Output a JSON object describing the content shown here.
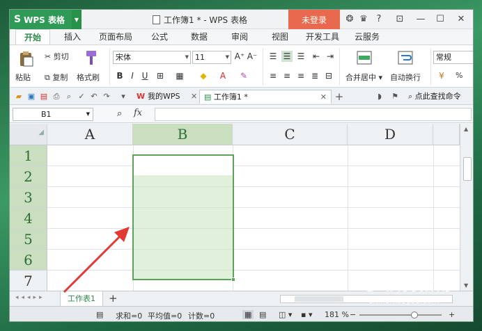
{
  "app": {
    "name": "WPS 表格",
    "window_title": "工作簿1 * - WPS 表格",
    "login_label": "未登录"
  },
  "menu": {
    "tabs": [
      "开始",
      "插入",
      "页面布局",
      "公式",
      "数据",
      "审阅",
      "视图",
      "开发工具",
      "云服务"
    ]
  },
  "ribbon": {
    "paste": "粘贴",
    "cut": "剪切",
    "copy": "复制",
    "format_painter": "格式刷",
    "font_name": "宋体",
    "font_size": "11",
    "merge_center": "合并居中",
    "wrap_text": "自动换行",
    "number_format": "常规",
    "percent": "%"
  },
  "quickbar": {
    "tab1": "我的WPS",
    "tab2": "工作簿1 *",
    "search": "点此查找命令"
  },
  "formula_bar": {
    "name_box": "B1",
    "fx": "fx",
    "value": ""
  },
  "grid": {
    "columns": [
      "A",
      "B",
      "C",
      "D"
    ],
    "rows": [
      "1",
      "2",
      "3",
      "4",
      "5",
      "6",
      "7"
    ],
    "selected_column": "B"
  },
  "sheets": {
    "active": "工作表1",
    "add": "+"
  },
  "status": {
    "sum": "求和=0",
    "avg": "平均值=0",
    "count": "计数=0",
    "zoom": "181 %"
  },
  "watermark": {
    "brand": "搜狗指南",
    "url": "zhinan.sogou.com"
  }
}
